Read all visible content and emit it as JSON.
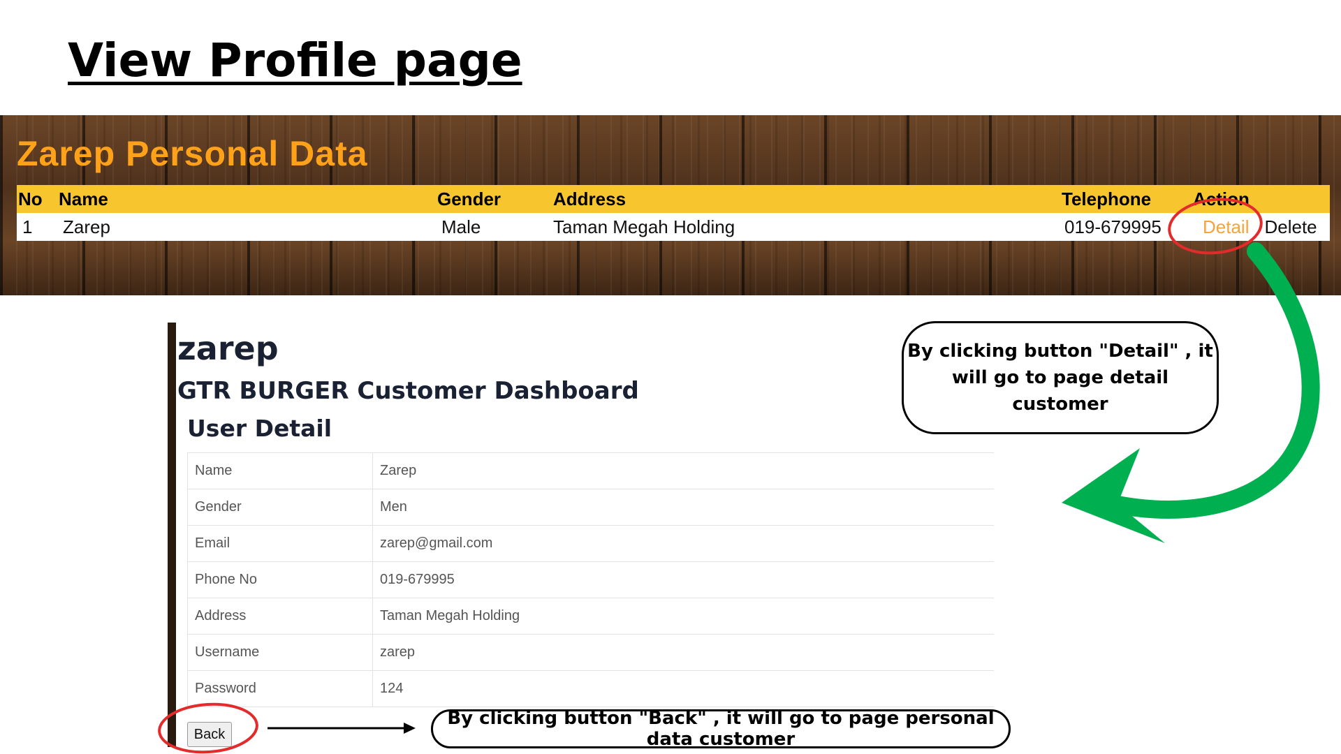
{
  "slide_title": "View Profile page",
  "personal_data": {
    "title": "Zarep Personal Data",
    "columns": [
      "No",
      "Name",
      "Gender",
      "Address",
      "Telephone",
      "Action"
    ],
    "row": {
      "no": "1",
      "name": "Zarep",
      "gender": "Male",
      "address": "Taman Megah Holding",
      "telephone": "019-679995",
      "detail_label": "Detail",
      "delete_label": "Delete"
    }
  },
  "customer_panel": {
    "customer_name": "zarep",
    "dashboard_title": "GTR BURGER Customer Dashboard",
    "section_title": "User Detail",
    "fields": [
      {
        "label": "Name",
        "value": "Zarep"
      },
      {
        "label": "Gender",
        "value": "Men"
      },
      {
        "label": "Email",
        "value": "zarep@gmail.com"
      },
      {
        "label": "Phone No",
        "value": "019-679995"
      },
      {
        "label": "Address",
        "value": "Taman Megah Holding"
      },
      {
        "label": "Username",
        "value": "zarep"
      },
      {
        "label": "Password",
        "value": "124"
      }
    ],
    "back_label": "Back"
  },
  "callouts": {
    "detail": "By clicking button \"Detail\" , it will go to page detail customer",
    "back": "By clicking button \"Back\" , it will go to page personal data customer"
  },
  "colors": {
    "banner_title": "#ffa21a",
    "table_header": "#f7c62f",
    "detail_link": "#f5a33b",
    "highlight_circle": "#e32b2b",
    "arrow_green": "#00b050"
  }
}
